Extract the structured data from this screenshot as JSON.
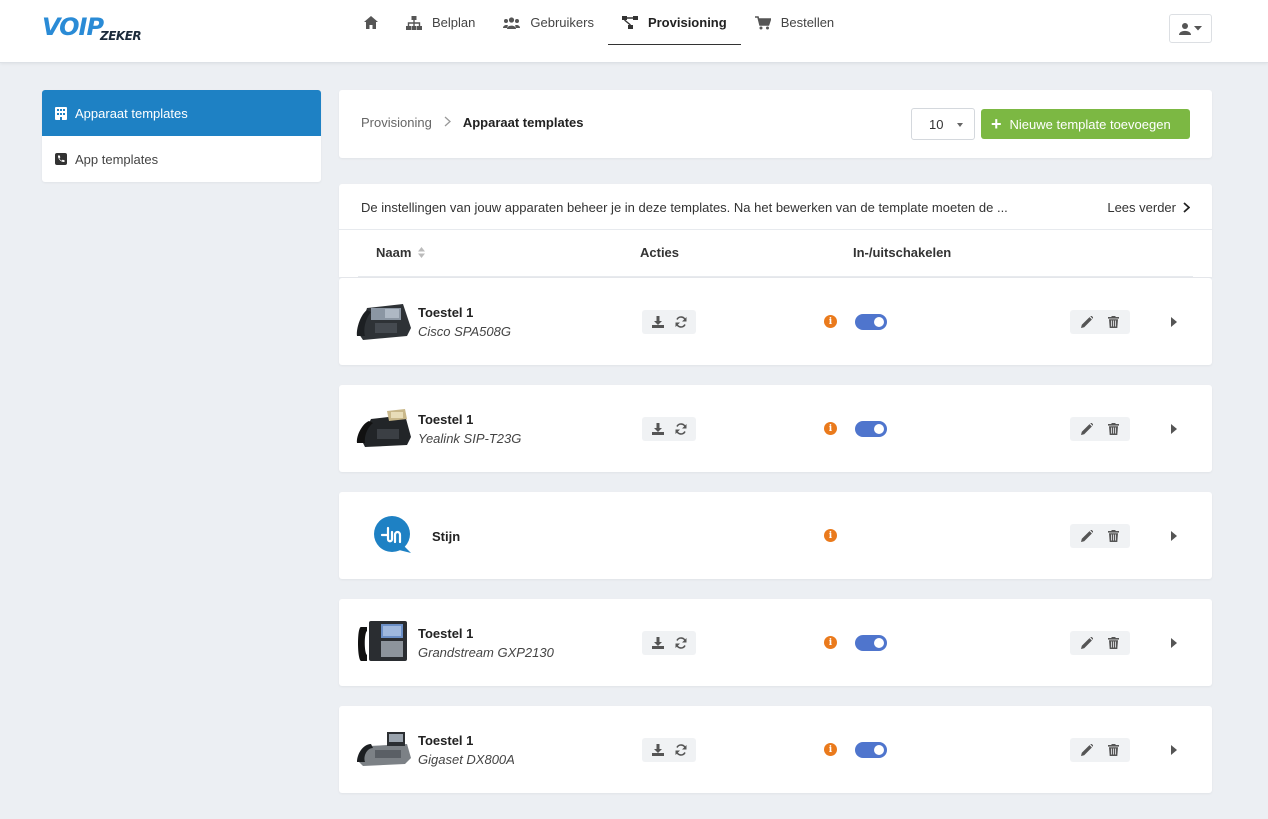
{
  "brand": {
    "logo_main": "VOIP",
    "logo_sub": "ZEKER"
  },
  "nav": {
    "items": [
      {
        "id": "home",
        "label": "",
        "icon": "home-icon",
        "active": false
      },
      {
        "id": "belplan",
        "label": "Belplan",
        "icon": "sitemap-icon",
        "active": false
      },
      {
        "id": "gebruikers",
        "label": "Gebruikers",
        "icon": "users-icon",
        "active": false
      },
      {
        "id": "provisioning",
        "label": "Provisioning",
        "icon": "project-diagram-icon",
        "active": true
      },
      {
        "id": "bestellen",
        "label": "Bestellen",
        "icon": "shopping-cart-icon",
        "active": false
      }
    ]
  },
  "sidebar": {
    "items": [
      {
        "label": "Apparaat templates",
        "icon": "building-icon",
        "active": true
      },
      {
        "label": "App templates",
        "icon": "phone-square-icon",
        "active": false
      }
    ]
  },
  "breadcrumb": {
    "parent": "Provisioning",
    "current": "Apparaat templates"
  },
  "page_size": {
    "selected": "10"
  },
  "add_button": {
    "label": "Nieuwe template toevoegen"
  },
  "info": {
    "text": "De instellingen van jouw apparaten beheer je in deze templates. Na het bewerken van de template moeten de ...",
    "read_more": "Lees verder"
  },
  "table": {
    "headers": {
      "name": "Naam",
      "actions": "Acties",
      "toggle": "In-/uitschakelen"
    },
    "rows": [
      {
        "name": "Toestel 1",
        "model": "Cisco SPA508G",
        "type": "device",
        "enabled": true
      },
      {
        "name": "Toestel 1",
        "model": "Yealink SIP-T23G",
        "type": "device",
        "enabled": true
      },
      {
        "name": "Stijn",
        "model": "",
        "type": "app",
        "enabled": null
      },
      {
        "name": "Toestel 1",
        "model": "Grandstream GXP2130",
        "type": "device",
        "enabled": true
      },
      {
        "name": "Toestel 1",
        "model": "Gigaset DX800A",
        "type": "device",
        "enabled": true
      }
    ]
  },
  "colors": {
    "primary": "#1e81c4",
    "success": "#7cb843",
    "warning": "#ea7a1c",
    "toggle_on": "#4f75cd",
    "background": "#eceff3"
  }
}
